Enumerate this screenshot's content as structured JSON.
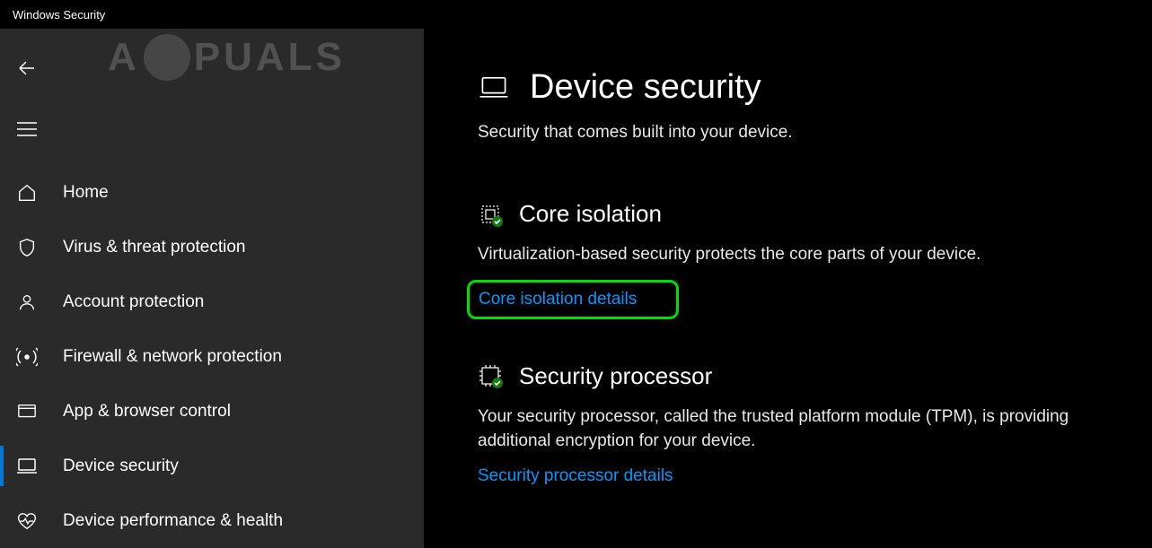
{
  "titlebar": {
    "app_name": "Windows Security"
  },
  "watermark": {
    "text_left": "A",
    "text_right": "PUALS"
  },
  "sidebar": {
    "items": [
      {
        "label": "Home",
        "icon": "home-icon",
        "active": false
      },
      {
        "label": "Virus & threat protection",
        "icon": "shield-icon",
        "active": false
      },
      {
        "label": "Account protection",
        "icon": "person-icon",
        "active": false
      },
      {
        "label": "Firewall & network protection",
        "icon": "antenna-icon",
        "active": false
      },
      {
        "label": "App & browser control",
        "icon": "app-icon",
        "active": false
      },
      {
        "label": "Device security",
        "icon": "laptop-icon",
        "active": true
      },
      {
        "label": "Device performance & health",
        "icon": "heart-icon",
        "active": false
      }
    ]
  },
  "main": {
    "page_icon": "laptop-icon",
    "title": "Device security",
    "subtitle": "Security that comes built into your device.",
    "sections": [
      {
        "icon": "chip-check-icon",
        "title": "Core isolation",
        "description": "Virtualization-based security protects the core parts of your device.",
        "link_label": "Core isolation details",
        "link_highlighted": true
      },
      {
        "icon": "chip-check-icon",
        "title": "Security processor",
        "description": "Your security processor, called the trusted platform module (TPM), is providing additional encryption for your device.",
        "link_label": "Security processor details",
        "link_highlighted": false
      }
    ]
  },
  "colors": {
    "link": "#0099ff",
    "accent": "#0078d4",
    "highlight": "#00e000"
  }
}
